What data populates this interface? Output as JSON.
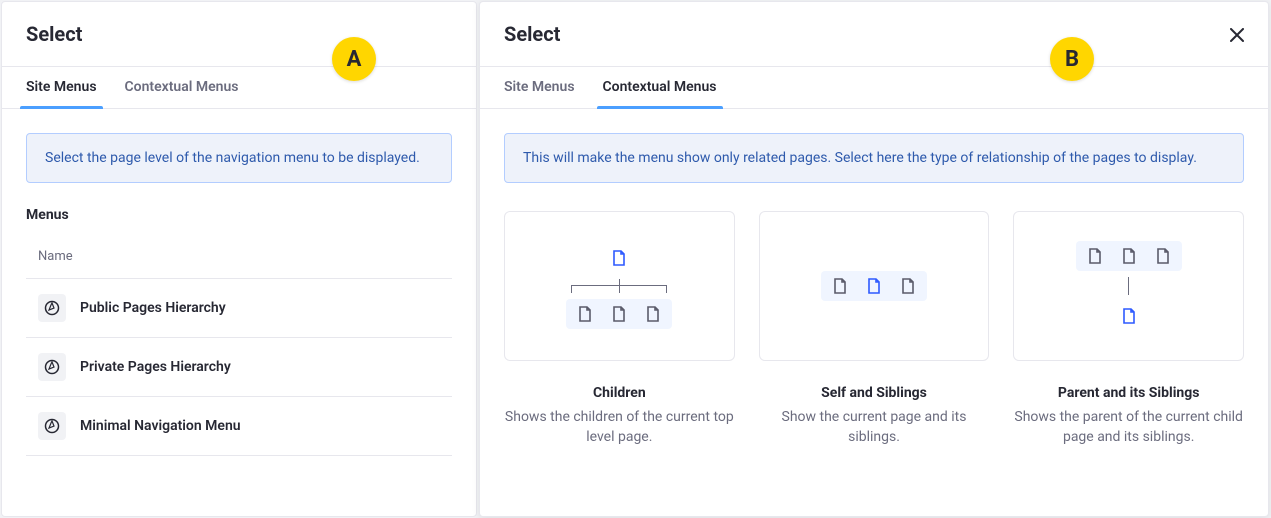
{
  "badges": {
    "a": "A",
    "b": "B"
  },
  "panelA": {
    "title": "Select",
    "tabs": {
      "site": "Site Menus",
      "contextual": "Contextual Menus"
    },
    "activeTab": "site",
    "alert": "Select the page level of the navigation menu to be displayed.",
    "sectionTitle": "Menus",
    "columnHeader": "Name",
    "menus": [
      {
        "label": "Public Pages Hierarchy"
      },
      {
        "label": "Private Pages Hierarchy"
      },
      {
        "label": "Minimal Navigation Menu"
      }
    ]
  },
  "panelB": {
    "title": "Select",
    "tabs": {
      "site": "Site Menus",
      "contextual": "Contextual Menus"
    },
    "activeTab": "contextual",
    "alert": "This will make the menu show only related pages. Select here the type of relationship of the pages to display.",
    "cards": [
      {
        "title": "Children",
        "desc": "Shows the children of the current top level page."
      },
      {
        "title": "Self and Siblings",
        "desc": "Show the current page and its siblings."
      },
      {
        "title": "Parent and its Siblings",
        "desc": "Shows the parent of the current child page and its siblings."
      }
    ]
  }
}
